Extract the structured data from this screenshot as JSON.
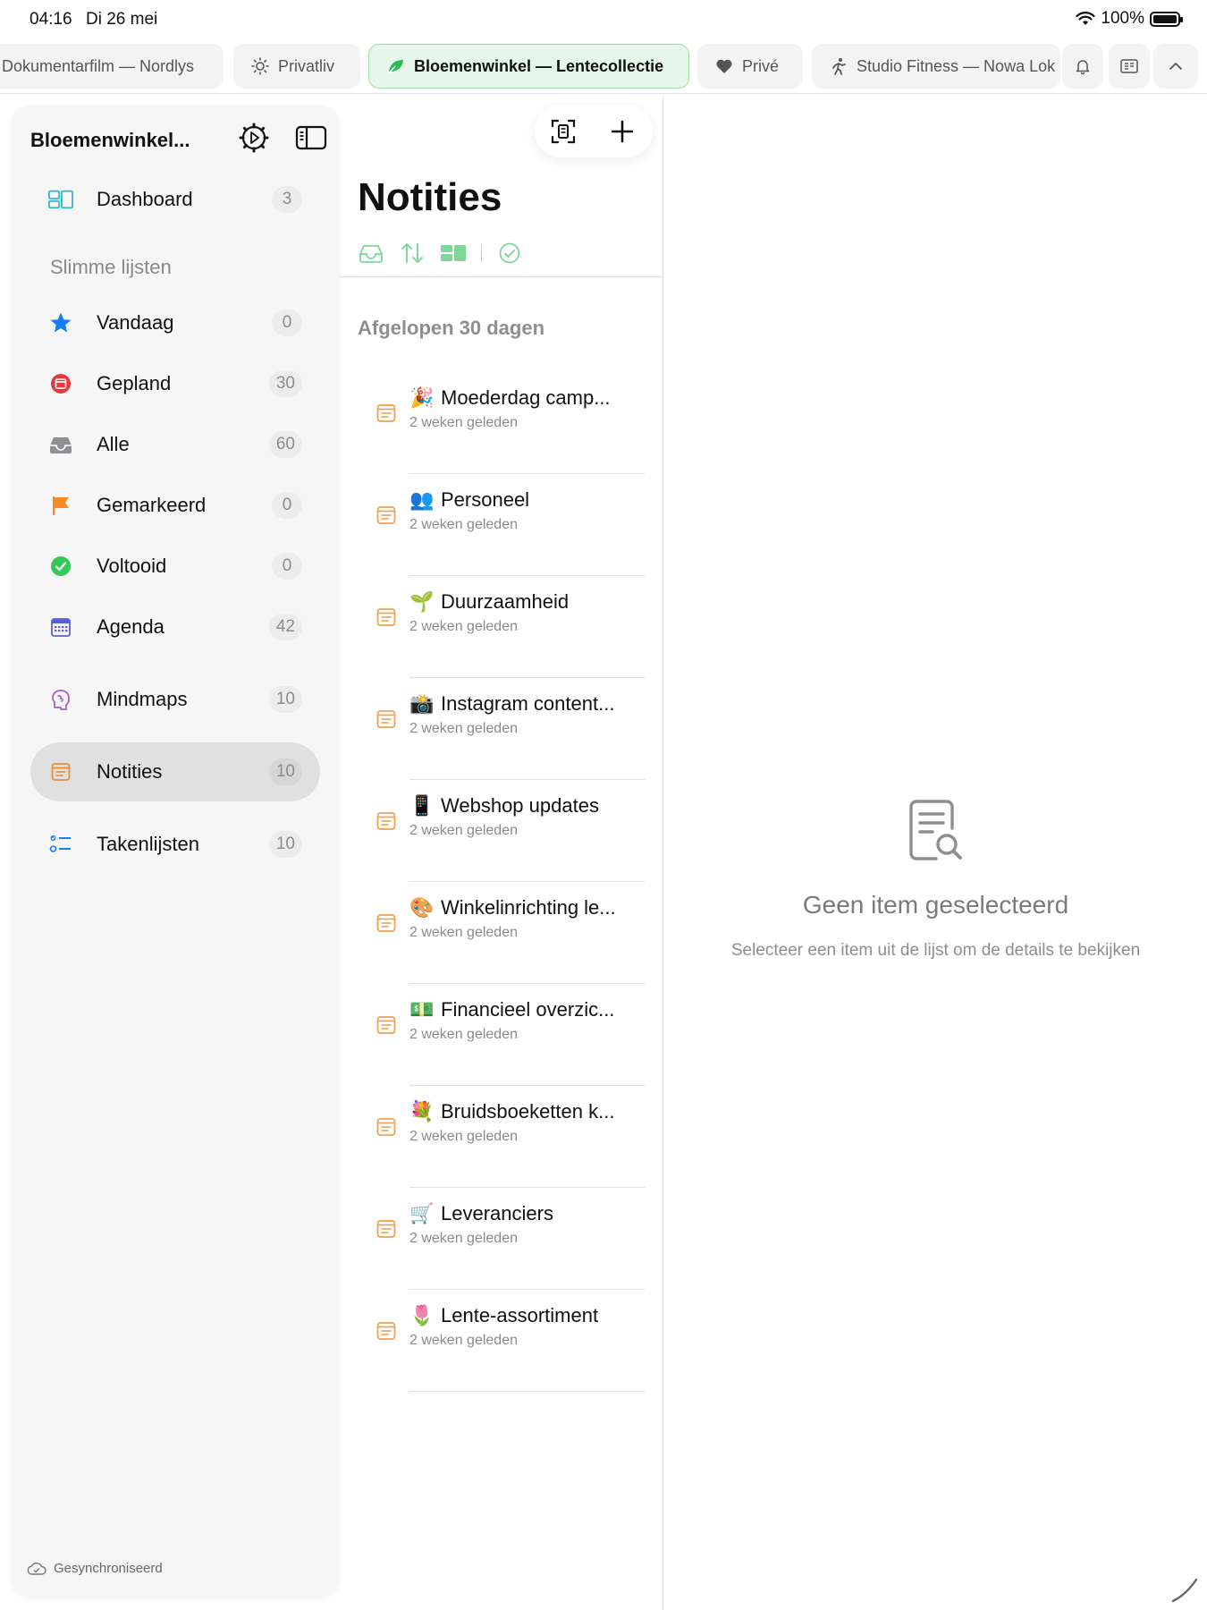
{
  "status": {
    "time": "04:16",
    "date": "Di 26 mei",
    "battery": "100%"
  },
  "tabs": [
    {
      "label": "Dokumentarfilm — Nordlys",
      "icon": "none"
    },
    {
      "label": "Privatliv",
      "icon": "sun-icon"
    },
    {
      "label": "Bloemenwinkel — Lentecollectie",
      "icon": "leaf-icon",
      "active": true
    },
    {
      "label": "Privé",
      "icon": "heart-icon"
    },
    {
      "label": "Studio Fitness — Nowa Lok",
      "icon": "runner-icon"
    }
  ],
  "sidebar": {
    "title": "Bloemenwinkel...",
    "dashboard": {
      "label": "Dashboard",
      "count": "3"
    },
    "section": "Slimme lijsten",
    "items": [
      {
        "label": "Vandaag",
        "count": "0",
        "icon": "star-icon"
      },
      {
        "label": "Gepland",
        "count": "30",
        "icon": "calendar-red-icon"
      },
      {
        "label": "Alle",
        "count": "60",
        "icon": "inbox-icon"
      },
      {
        "label": "Gemarkeerd",
        "count": "0",
        "icon": "flag-icon"
      },
      {
        "label": "Voltooid",
        "count": "0",
        "icon": "check-circle-icon"
      },
      {
        "label": "Agenda",
        "count": "42",
        "icon": "calendar-grid-icon"
      }
    ],
    "extra": [
      {
        "label": "Mindmaps",
        "count": "10",
        "icon": "brain-icon"
      },
      {
        "label": "Notities",
        "count": "10",
        "icon": "note-icon",
        "active": true
      },
      {
        "label": "Takenlijsten",
        "count": "10",
        "icon": "checklist-icon"
      }
    ],
    "footer": "Gesynchroniseerd"
  },
  "list": {
    "title": "Notities",
    "section": "Afgelopen 30 dagen",
    "notes": [
      {
        "emoji": "🎉",
        "title": "Moederdag camp...",
        "sub": "2 weken geleden"
      },
      {
        "emoji": "👥",
        "title": "Personeel",
        "sub": "2 weken geleden"
      },
      {
        "emoji": "🌱",
        "title": "Duurzaamheid",
        "sub": "2 weken geleden"
      },
      {
        "emoji": "📸",
        "title": "Instagram content...",
        "sub": "2 weken geleden"
      },
      {
        "emoji": "📱",
        "title": "Webshop updates",
        "sub": "2 weken geleden"
      },
      {
        "emoji": "🎨",
        "title": "Winkelinrichting le...",
        "sub": "2 weken geleden"
      },
      {
        "emoji": "💵",
        "title": "Financieel overzic...",
        "sub": "2 weken geleden"
      },
      {
        "emoji": "💐",
        "title": "Bruidsboeketten k...",
        "sub": "2 weken geleden"
      },
      {
        "emoji": "🛒",
        "title": "Leveranciers",
        "sub": "2 weken geleden"
      },
      {
        "emoji": "🌷",
        "title": "Lente-assortiment",
        "sub": "2 weken geleden"
      }
    ]
  },
  "detail": {
    "title": "Geen item geselecteerd",
    "subtitle": "Selecteer een item uit de lijst om de details te bekijken"
  },
  "colors": {
    "accent_green": "#34c759",
    "note_orange": "#f0a050",
    "active_tab_bg": "#e6f7e9"
  }
}
